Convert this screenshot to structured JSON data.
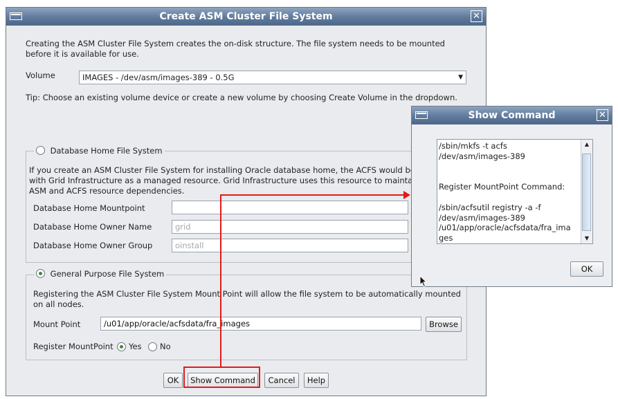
{
  "main_dialog": {
    "title": "Create ASM Cluster File System",
    "intro_line1": "Creating the ASM Cluster File System creates the on-disk structure. The file system needs to be mounted",
    "intro_line2": "before it is available for use.",
    "volume_label": "Volume",
    "volume_value": "IMAGES - /dev/asm/images-389 - 0.5G",
    "tip": "Tip: Choose an existing volume device or create a new volume by choosing Create Volume in the dropdown.",
    "db_home": {
      "legend": "Database Home File System",
      "selected": false,
      "desc_line1": "If you create an ASM Cluster File System for installing Oracle database home, the ACFS would be r",
      "desc_line2": "with Grid Infrastructure as a managed resource. Grid Infrastructure uses this resource to maintai",
      "desc_line3": "ASM and ACFS resource dependencies.",
      "mountpoint_label": "Database Home Mountpoint",
      "mountpoint_value": "",
      "owner_name_label": "Database Home Owner Name",
      "owner_name_value": "grid",
      "owner_group_label": "Database Home Owner Group",
      "owner_group_value": "oinstall"
    },
    "general": {
      "legend": "General Purpose File System",
      "selected": true,
      "desc_line1": "Registering the ASM Cluster File System Mount Point will allow the file system to be automatically mounted",
      "desc_line2": "on all nodes.",
      "mount_point_label": "Mount Point",
      "mount_point_value": "/u01/app/oracle/acfsdata/fra_images",
      "browse_label": "Browse",
      "register_label": "Register MountPoint",
      "yes_label": "Yes",
      "no_label": "No",
      "register_value": "Yes"
    },
    "buttons": {
      "ok": "OK",
      "show_command": "Show Command",
      "cancel": "Cancel",
      "help": "Help"
    }
  },
  "show_command_dialog": {
    "title": "Show Command",
    "lines": [
      "/sbin/mkfs -t acfs",
      "/dev/asm/images-389",
      "",
      "",
      "Register MountPoint Command:",
      "",
      "/sbin/acfsutil registry -a -f",
      "/dev/asm/images-389",
      "/u01/app/oracle/acfsdata/fra_ima",
      "ges"
    ],
    "ok": "OK"
  },
  "annotation_color": "#e21a1a"
}
